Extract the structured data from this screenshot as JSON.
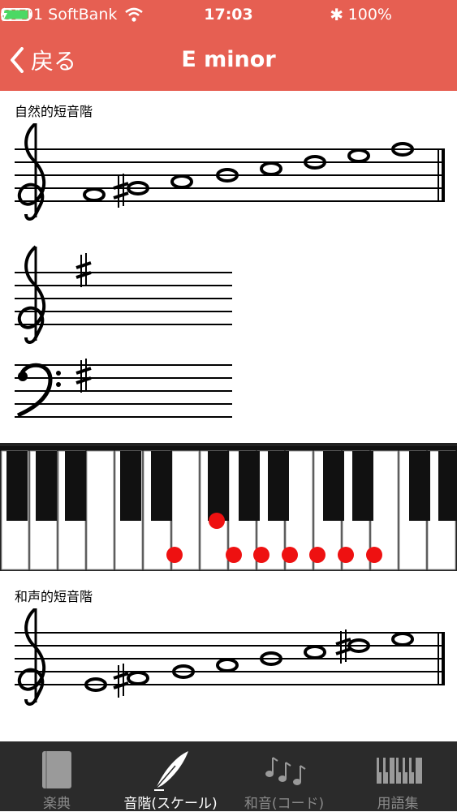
{
  "status": {
    "carrier": "-101 SoftBank",
    "time": "17:03",
    "battery_pct": "100%"
  },
  "nav": {
    "back_label": "戻る",
    "title": "E minor"
  },
  "sections": [
    {
      "label": "自然的短音階"
    },
    {
      "label": "和声的短音階"
    }
  ],
  "keyboard": {
    "marked_keys": [
      "E",
      "F#",
      "G",
      "A",
      "B",
      "C",
      "D",
      "E"
    ]
  },
  "tabs": [
    {
      "label": "楽典",
      "icon": "book-icon",
      "active": false
    },
    {
      "label": "音階(スケール)",
      "icon": "quill-icon",
      "active": true
    },
    {
      "label": "和音(コード)",
      "icon": "music-notes-icon",
      "active": false
    },
    {
      "label": "用語集",
      "icon": "piano-keys-icon",
      "active": false
    }
  ],
  "colors": {
    "header": "#e65f52",
    "marker": "#ee1111",
    "tabbar": "#2b2b2b",
    "battery": "#4cd964"
  }
}
